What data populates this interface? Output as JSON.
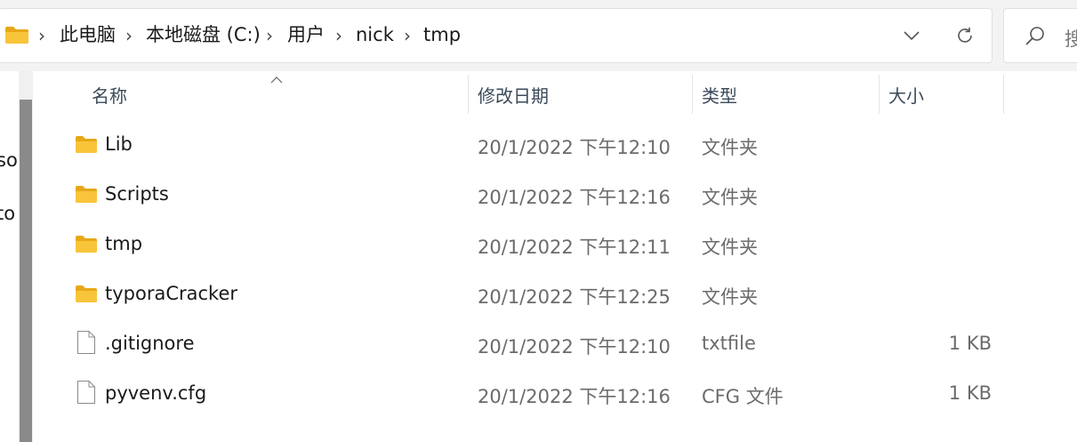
{
  "address_bar": {
    "folder_icon": "folder-icon",
    "breadcrumbs": [
      "此电脑",
      "本地磁盘 (C:)",
      "用户",
      "nick",
      "tmp"
    ],
    "separator": "›",
    "dropdown_icon": "chevron-down-icon",
    "refresh_icon": "refresh-icon"
  },
  "search": {
    "icon": "search-icon",
    "placeholder": "搜"
  },
  "nav_pane": {
    "partial_items": [
      "so",
      "to"
    ]
  },
  "columns": {
    "name": "名称",
    "date": "修改日期",
    "type": "类型",
    "size": "大小",
    "sort_indicator": "^"
  },
  "files": [
    {
      "name": "Lib",
      "date": "20/1/2022 下午12:10",
      "type": "文件夹",
      "size": "",
      "icon": "folder-icon"
    },
    {
      "name": "Scripts",
      "date": "20/1/2022 下午12:16",
      "type": "文件夹",
      "size": "",
      "icon": "folder-icon"
    },
    {
      "name": "tmp",
      "date": "20/1/2022 下午12:11",
      "type": "文件夹",
      "size": "",
      "icon": "folder-icon"
    },
    {
      "name": "typoraCracker",
      "date": "20/1/2022 下午12:25",
      "type": "文件夹",
      "size": "",
      "icon": "folder-icon"
    },
    {
      "name": ".gitignore",
      "date": "20/1/2022 下午12:10",
      "type": "txtfile",
      "size": "1 KB",
      "icon": "file-icon"
    },
    {
      "name": "pyvenv.cfg",
      "date": "20/1/2022 下午12:16",
      "type": "CFG 文件",
      "size": "1 KB",
      "icon": "file-icon"
    }
  ],
  "colors": {
    "folder_yellow": "#f8c43a",
    "folder_dark": "#e6a817",
    "header_text": "#3c4a5a",
    "secondary_text": "#6b6b6b",
    "scrollbar": "#8a8a8a"
  }
}
